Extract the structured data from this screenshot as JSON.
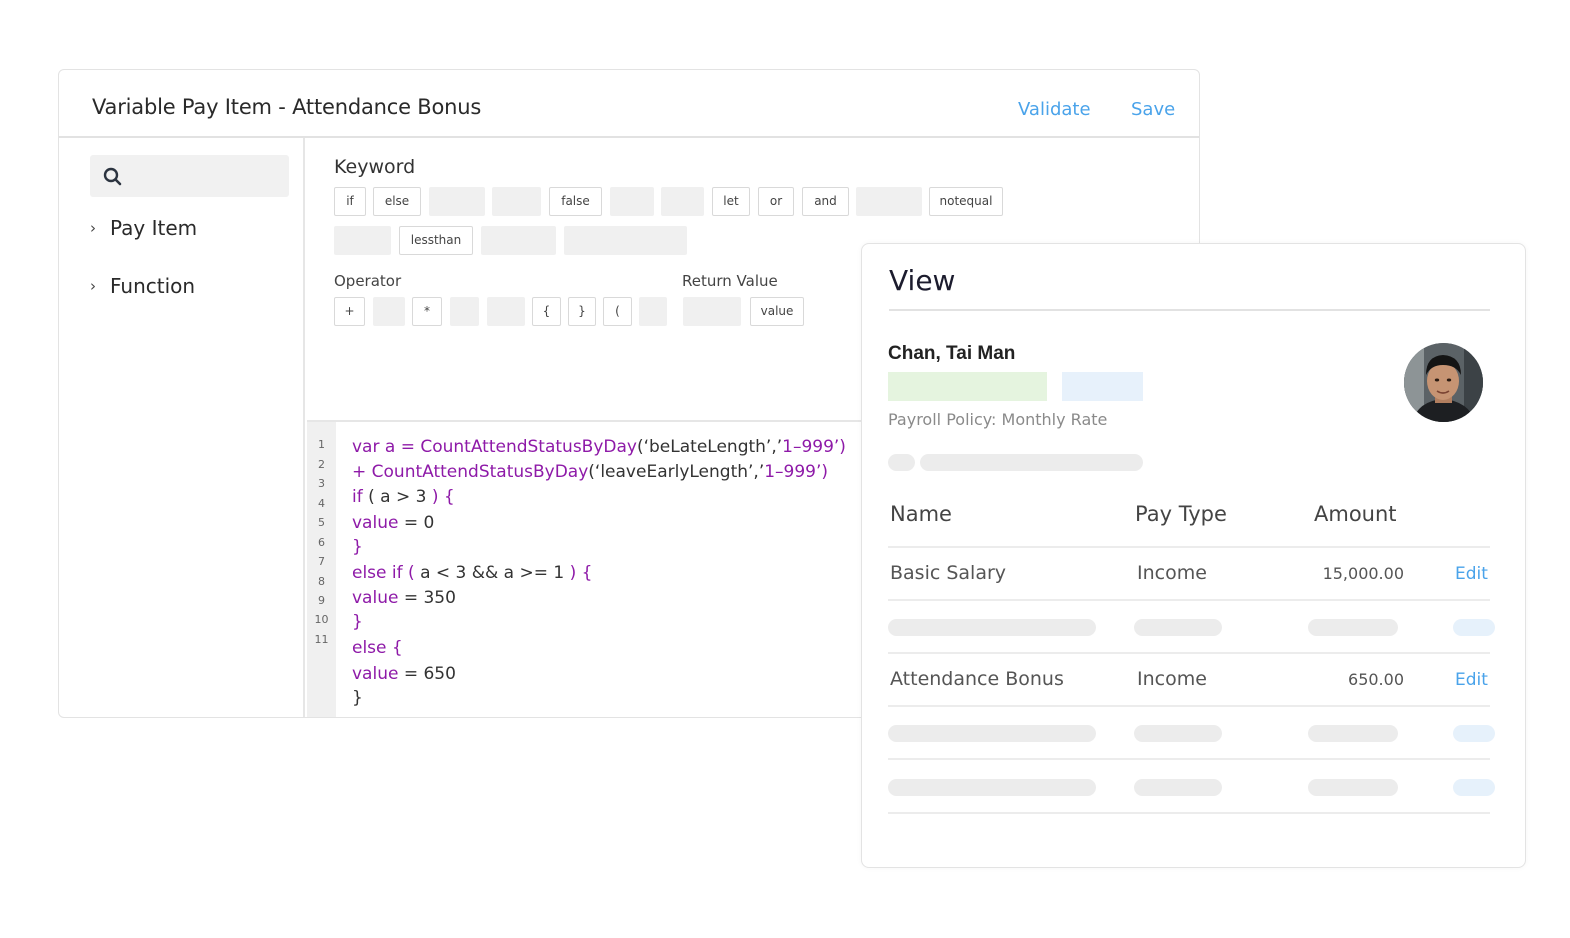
{
  "editor": {
    "title": "Variable Pay Item - Attendance Bonus",
    "validate_label": "Validate",
    "save_label": "Save"
  },
  "sidebar": {
    "search_icon": "search-icon",
    "items": [
      {
        "label": "Pay Item"
      },
      {
        "label": "Function"
      }
    ]
  },
  "keywords": {
    "heading": "Keyword",
    "row1": [
      "if",
      "else",
      "",
      "",
      "false",
      "",
      "",
      "let",
      "or",
      "and",
      "",
      "notequal"
    ],
    "row2": [
      "",
      "lessthan",
      "",
      ""
    ]
  },
  "operators": {
    "heading": "Operator",
    "items": [
      "+",
      "",
      "*",
      "",
      "",
      "{",
      "}",
      "(",
      ""
    ]
  },
  "return_value": {
    "heading": "Return Value",
    "items": [
      "",
      "value"
    ]
  },
  "code": {
    "line_numbers": [
      "1",
      "2",
      "3",
      "4",
      "5",
      "6",
      "7",
      "8",
      "9",
      "10",
      "11"
    ],
    "l1a": "var a = ",
    "l1b": "CountAttendStatusByDay",
    "l1c": "(‘beLateLength’,’",
    "l1d": "1–999’)",
    "l2a": "+ CountAttendStatusByDay",
    "l2b": "(‘leaveEarlyLength’,’",
    "l2c": "1–999’)",
    "l3a": "if",
    "l3b": " ( a > 3 ",
    "l3c": ") {",
    "l4a": "value",
    "l4b": " = 0",
    "l5": "}",
    "l6a": "else if ( ",
    "l6b": "a < 3 && a >= 1 ",
    "l6c": ") {",
    "l7a": "value",
    "l7b": " = 350",
    "l8": "}",
    "l9": "else {",
    "l10a": "value",
    "l10b": " = 650",
    "l11": "}"
  },
  "view": {
    "title": "View",
    "employee_name": "Chan, Tai Man",
    "payroll_policy": "Payroll Policy: Monthly Rate",
    "columns": [
      "Name",
      "Pay Type",
      "Amount"
    ],
    "rows": [
      {
        "name": "Basic Salary",
        "type": "Income",
        "amount": "15,000.00",
        "action": "Edit"
      },
      {
        "name": "Attendance Bonus",
        "type": "Income",
        "amount": "650.00",
        "action": "Edit"
      }
    ],
    "colors": {
      "accent": "#4aa3ea",
      "keyword": "#8e1aa8",
      "tag_green": "#e5f4df",
      "tag_blue": "#e7f1fb"
    }
  }
}
